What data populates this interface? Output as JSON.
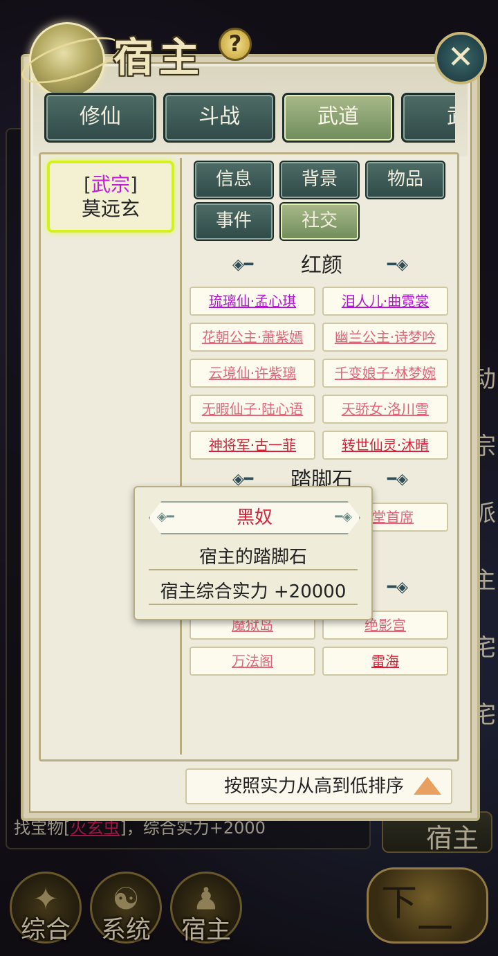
{
  "background": {
    "log_line_prefix": "找宝物[",
    "log_line_link": "火玄虫",
    "log_line_suffix": "]，综合实力+2000",
    "right_column_glyphs": [
      "动",
      "宗",
      "派",
      "主",
      "宅",
      "宅"
    ],
    "host_tab": "宿主"
  },
  "bottom_nav": {
    "items": [
      {
        "label": "综合",
        "icon": "✦"
      },
      {
        "label": "系统",
        "icon": "☯"
      },
      {
        "label": "宿主",
        "icon": "♟"
      }
    ],
    "next_month_top": "下",
    "next_month_bottom": "一月"
  },
  "header": {
    "title": "宿主",
    "help_icon": "?",
    "close_icon": "✕"
  },
  "tabs": [
    {
      "label": "修仙",
      "active": false
    },
    {
      "label": "斗战",
      "active": false
    },
    {
      "label": "武道",
      "active": true
    },
    {
      "label": "武",
      "active": false
    }
  ],
  "host": {
    "bracket_open": "[",
    "sect": "武宗",
    "bracket_close": "]",
    "name": "莫远玄"
  },
  "subtabs": [
    {
      "label": "信息",
      "active": false
    },
    {
      "label": "背景",
      "active": false
    },
    {
      "label": "物品",
      "active": false
    },
    {
      "label": "事件",
      "active": false
    },
    {
      "label": "社交",
      "active": true
    }
  ],
  "sections": {
    "beauties": {
      "title": "红颜",
      "items": [
        {
          "label": "琉璃仙·孟心琪",
          "color": "purple"
        },
        {
          "label": "泪人儿·曲霓裳",
          "color": "purple"
        },
        {
          "label": "花朝公主·萧紫嫣",
          "color": "pink"
        },
        {
          "label": "幽兰公主·诗梦吟",
          "color": "pink"
        },
        {
          "label": "云境仙·许紫璃",
          "color": "pink"
        },
        {
          "label": "千变娘子·林梦婉",
          "color": "pink"
        },
        {
          "label": "无暇仙子·陆心语",
          "color": "pink"
        },
        {
          "label": "天骄女·洛川雪",
          "color": "pink"
        },
        {
          "label": "神将军·古一菲",
          "color": "red"
        },
        {
          "label": "转世仙灵·沐晴",
          "color": "red"
        }
      ]
    },
    "stepping_stones": {
      "title": "踏脚石",
      "visible_item": "堂首席"
    },
    "enemies": {
      "items": [
        {
          "label": "魔狱岛",
          "color": "pink"
        },
        {
          "label": "绝影宫",
          "color": "pink"
        },
        {
          "label": "万法阁",
          "color": "pink"
        },
        {
          "label": "雷海",
          "color": "red"
        }
      ]
    }
  },
  "tooltip": {
    "name": "黑奴",
    "description": "宿主的踏脚石",
    "effect": "宿主综合实力 +20000"
  },
  "sort": {
    "label": "按照实力从高到低排序"
  },
  "colors": {
    "purple": "#b216d0",
    "pink": "#e0667a",
    "red": "#d3233a",
    "tab_active": "#8aa46e",
    "tab_normal": "#3e5a56",
    "host_card_glow": "#d4f020"
  }
}
